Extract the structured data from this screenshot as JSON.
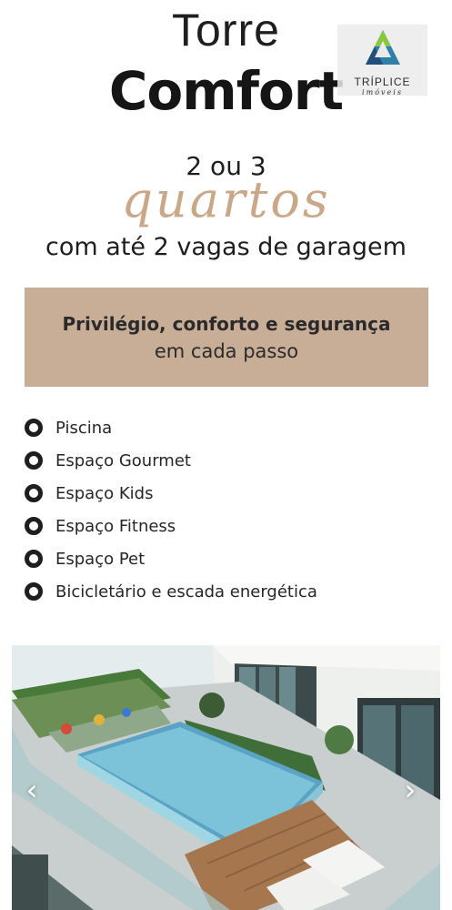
{
  "header": {
    "title_line1": "Torre",
    "title_line2": "Comfort"
  },
  "logo": {
    "name": "TRÍPLICE",
    "subtitle": "imóveis",
    "icon": "triangle-logo-icon",
    "colors": [
      "#2f7fa8",
      "#8cc63f",
      "#1f4f7a"
    ]
  },
  "rooms": {
    "numbers": "2 ou 3",
    "word": "quartos",
    "script_color": "#c9a789"
  },
  "parking": "com até 2 vagas de garagem",
  "banner": {
    "title": "Privilégio, conforto e segurança",
    "subtitle": "em cada passo",
    "background": "#c9ae97"
  },
  "features": [
    "Piscina",
    "Espaço Gourmet",
    "Espaço Kids",
    "Espaço Fitness",
    "Espaço Pet",
    "Bicicletário e escada energética"
  ],
  "carousel": {
    "prev_icon": "chevron-left-icon",
    "next_icon": "chevron-right-icon",
    "prev_glyph": "‹",
    "next_glyph": "›"
  }
}
